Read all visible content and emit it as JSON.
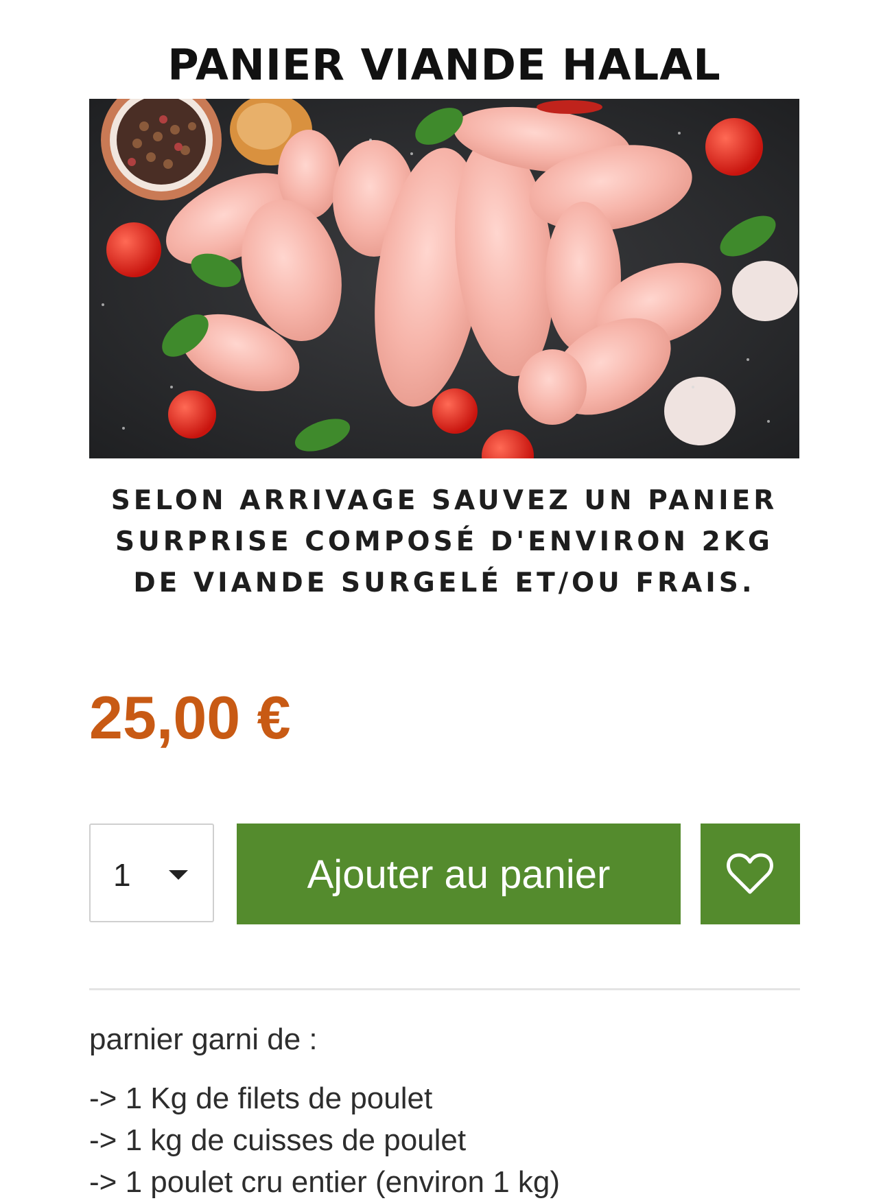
{
  "product": {
    "image_title": "PANIER VIANDE HALAL",
    "image_caption_lines": [
      "SELON ARRIVAGE SAUVEZ UN PANIER",
      "SURPRISE COMPOSÉ D'ENVIRON 2KG",
      "DE VIANDE SURGELÉ ET/OU FRAIS."
    ],
    "price": "25,00 €"
  },
  "purchase": {
    "quantity": "1",
    "add_to_cart_label": "Ajouter au panier",
    "wishlist_icon": "heart-icon"
  },
  "description": {
    "intro": "parnier garni de :",
    "items": [
      "-> 1 Kg de filets de poulet",
      "-> 1 kg de cuisses de poulet",
      "-> 1 poulet cru entier (environ 1 kg)"
    ]
  },
  "colors": {
    "price": "#c85a14",
    "button": "#548b2d"
  }
}
